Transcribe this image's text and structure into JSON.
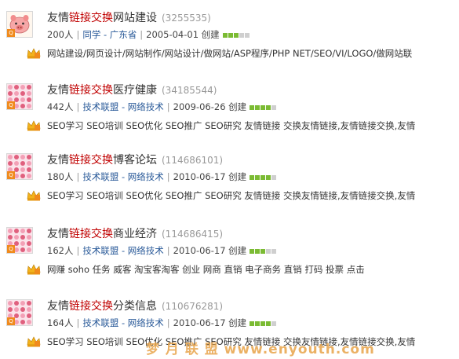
{
  "groups": [
    {
      "title_pre": "友情",
      "title_hl": "链接交换",
      "title_post": "网站建设",
      "id": "(3255535)",
      "members": "200人",
      "category": "同学 - 广东省",
      "date": "2005-04-01 创建",
      "activity_level": 3,
      "tags": "网站建设/网页设计/网站制作/网站设计/做网站/ASP程序/PHP NET/SEO/VI/LOGO/做网站联"
    },
    {
      "title_pre": "友情",
      "title_hl": "链接交换",
      "title_post": "医疗健康",
      "id": "(34185544)",
      "members": "442人",
      "category": "技术联盟 - 网络技术",
      "date": "2009-06-26 创建",
      "activity_level": 4,
      "tags": "SEO学习 SEO培训 SEO优化 SEO推广 SEO研究 友情链接 交换友情链接,友情链接交换,友情"
    },
    {
      "title_pre": "友情",
      "title_hl": "链接交换",
      "title_post": "博客论坛",
      "id": "(114686101)",
      "members": "180人",
      "category": "技术联盟 - 网络技术",
      "date": "2010-06-17 创建",
      "activity_level": 4,
      "tags": "SEO学习 SEO培训 SEO优化 SEO推广 SEO研究 友情链接 交换友情链接,友情链接交换,友情"
    },
    {
      "title_pre": "友情",
      "title_hl": "链接交换",
      "title_post": "商业经济",
      "id": "(114686415)",
      "members": "162人",
      "category": "技术联盟 - 网络技术",
      "date": "2010-06-17 创建",
      "activity_level": 3,
      "tags": "网赚 soho 任务 威客 淘宝客淘客 创业 网商 直销 电子商务 直销 打码 投票 点击"
    },
    {
      "title_pre": "友情",
      "title_hl": "链接交换",
      "title_post": "分类信息",
      "id": "(110676281)",
      "members": "164人",
      "category": "技术联盟 - 网络技术",
      "date": "2010-06-17 创建",
      "activity_level": 4,
      "tags": "SEO学习 SEO培训 SEO优化 SEO推广 SEO研究 友情链接 交换友情链接,友情链接交换,友情"
    }
  ],
  "watermark": "梦 月 联 盟 www.enyouth.com",
  "colors": {
    "highlight": "#c00000",
    "category_link": "#2a5a99",
    "activity_on": "#7bbb33",
    "activity_off": "#cfcfcf"
  },
  "icons": {
    "avatar": "group-avatar-icon",
    "tags": "crown-tag-icon"
  }
}
